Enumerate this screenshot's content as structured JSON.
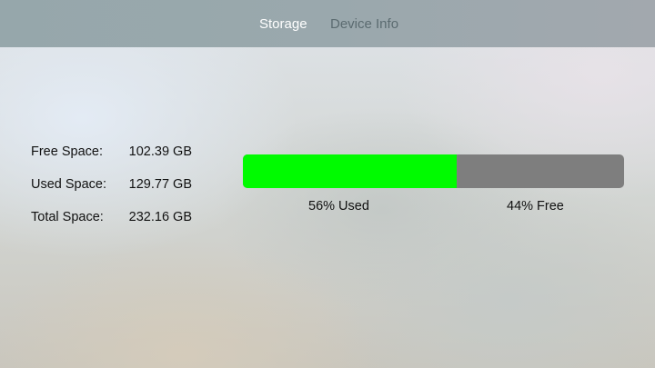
{
  "tabs": [
    {
      "label": "Storage",
      "selected": true
    },
    {
      "label": "Device Info",
      "selected": false
    }
  ],
  "storage": {
    "free": {
      "label": "Free Space:",
      "value": "102.39 GB"
    },
    "used": {
      "label": "Used Space:",
      "value": "129.77 GB"
    },
    "total": {
      "label": "Total Space:",
      "value": "232.16 GB"
    },
    "used_fraction": 0.56,
    "used_percent_label": "56% Used",
    "free_percent_label": "44% Free"
  },
  "colors": {
    "used_bar": "#00fb00",
    "free_bar": "#7e7e7e",
    "active_tab_text": "#ffffff",
    "inactive_tab_text": "#5b6b70"
  }
}
